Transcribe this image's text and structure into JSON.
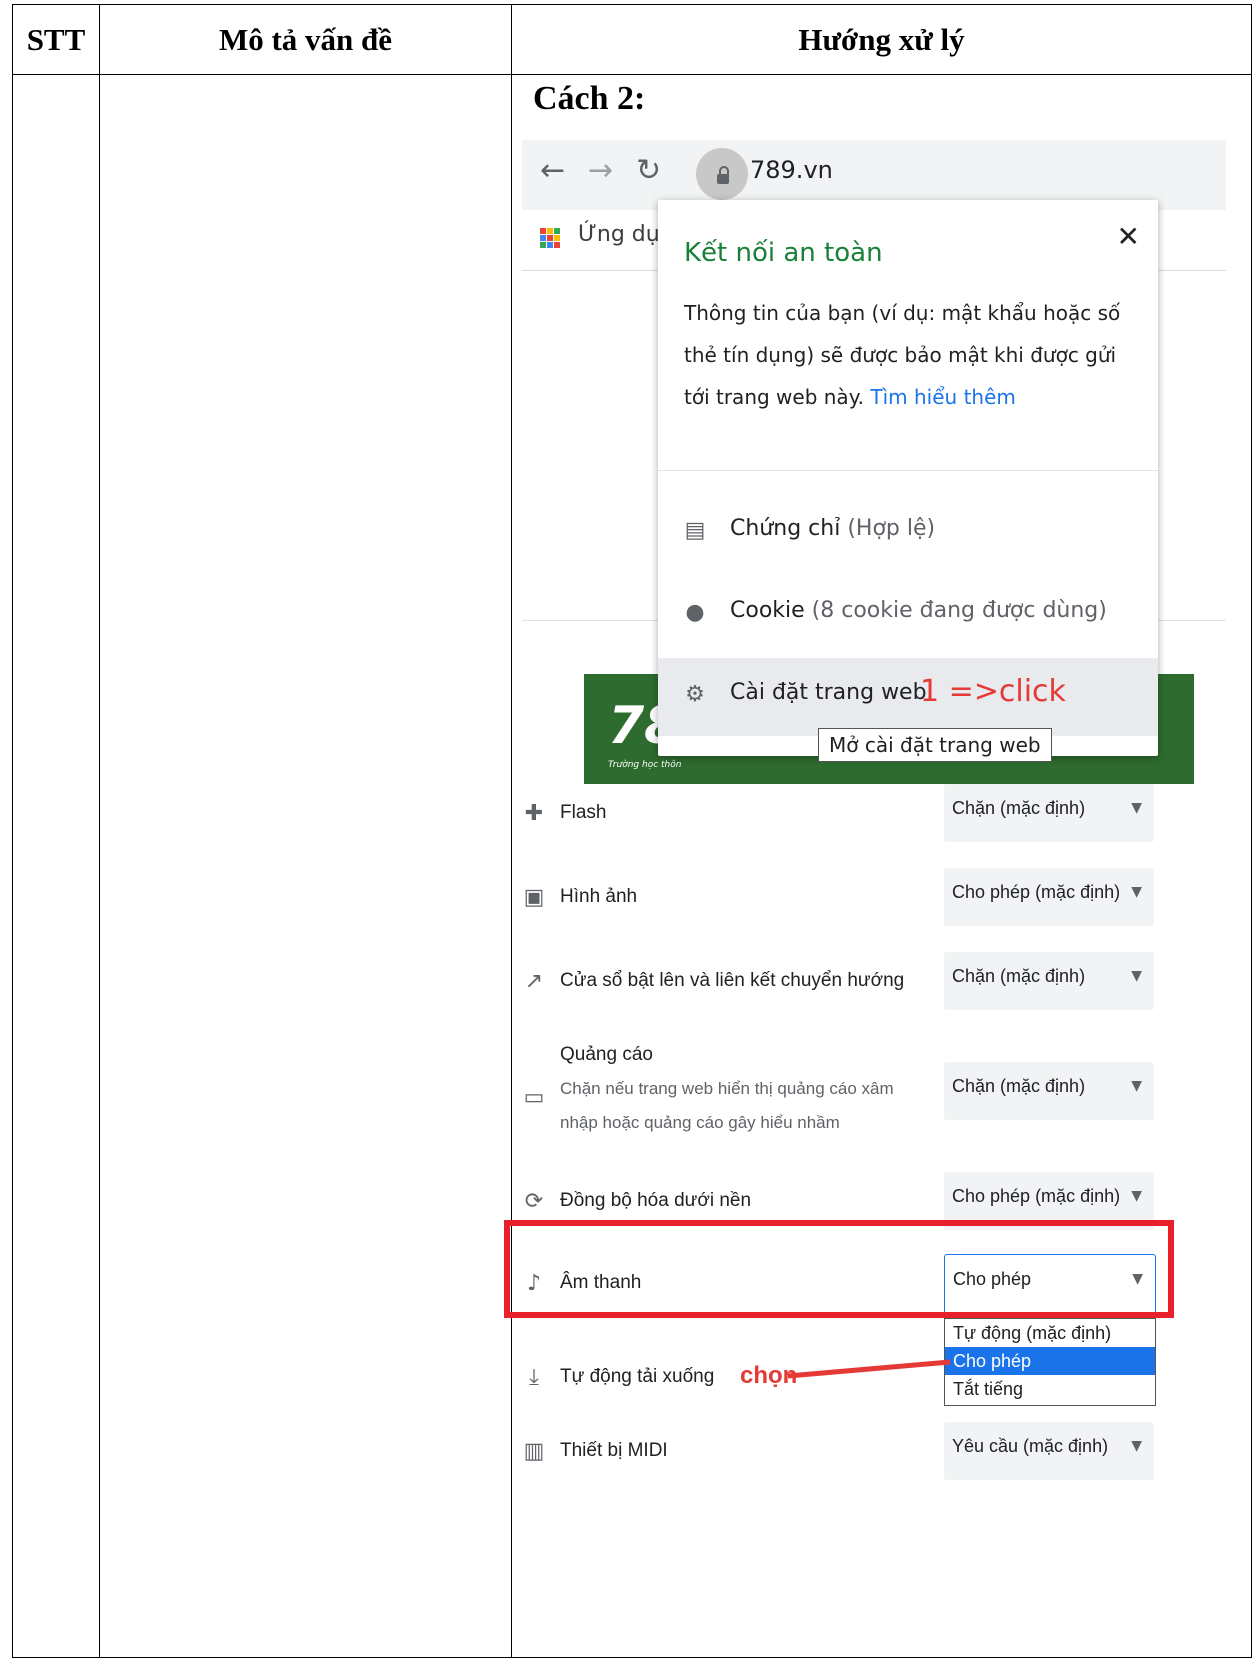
{
  "table": {
    "headers": [
      "STT",
      "Mô tả vấn đề",
      "Hướng xử lý"
    ],
    "step_title": "Cách 2:"
  },
  "browser": {
    "url": "789.vn",
    "bookmarks_label": "Ứng dụng"
  },
  "site": {
    "logo_text": "789.v",
    "logo_subtext": "Trường học thôn"
  },
  "popup": {
    "title": "Kết nối an toàn",
    "description": "Thông tin của bạn (ví dụ: mật khẩu hoặc số thẻ tín dụng) sẽ được bảo mật khi được gửi tới trang web này.",
    "learn_more": "Tìm hiểu thêm",
    "certificate_label": "Chứng chỉ",
    "certificate_status": "(Hợp lệ)",
    "cookie_label": "Cookie",
    "cookie_status": "(8 cookie đang được dùng)",
    "site_settings_label": "Cài đặt trang web",
    "click_note": "1 =>click",
    "tooltip": "Mở cài đặt trang web"
  },
  "settings": [
    {
      "label": "Flash",
      "value": "Chặn (mặc định)",
      "icon": "puzzle-icon"
    },
    {
      "label": "Hình ảnh",
      "value": "Cho phép (mặc định)",
      "icon": "image-icon"
    },
    {
      "label": "Cửa sổ bật lên và liên kết chuyển hướng",
      "value": "Chặn (mặc định)",
      "icon": "popup-icon"
    },
    {
      "label": "Quảng cáo",
      "description": "Chặn nếu trang web hiển thị quảng cáo xâm nhập hoặc quảng cáo gây hiểu nhầm",
      "value": "Chặn (mặc định)",
      "icon": "ads-icon"
    },
    {
      "label": "Đồng bộ hóa dưới nền",
      "value": "Cho phép (mặc định)",
      "icon": "sync-icon"
    },
    {
      "label": "Âm thanh",
      "value": "Cho phép",
      "icon": "sound-icon"
    },
    {
      "label": "Tự động tải xuống",
      "value": "",
      "icon": "download-icon"
    },
    {
      "label": "Thiết bị MIDI",
      "value": "Yêu cầu (mặc định)",
      "icon": "midi-icon"
    }
  ],
  "sound_dropdown": {
    "options": [
      "Tự động (mặc định)",
      "Cho phép",
      "Tắt tiếng"
    ],
    "selected": "Cho phép"
  },
  "annotation": {
    "choose_label": "chọn",
    "accent_color": "#e8202a"
  }
}
